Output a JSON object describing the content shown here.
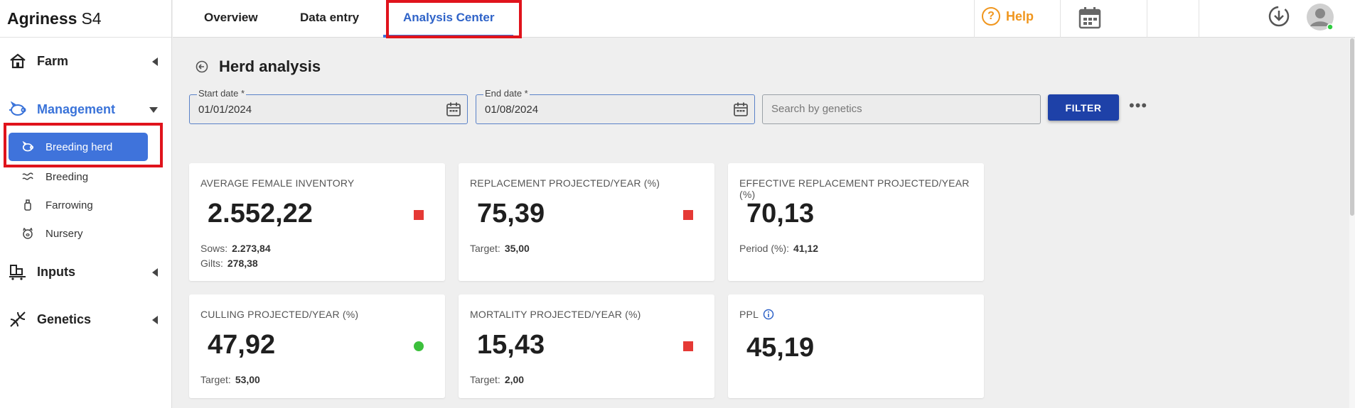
{
  "brand": {
    "name": "Agriness",
    "version": "S4"
  },
  "tabs": [
    {
      "label": "Overview"
    },
    {
      "label": "Data entry"
    },
    {
      "label": "Analysis Center"
    }
  ],
  "header": {
    "help_label": "Help"
  },
  "sidebar": {
    "sections": [
      {
        "label": "Farm"
      },
      {
        "label": "Management"
      },
      {
        "label": "Inputs"
      },
      {
        "label": "Genetics"
      }
    ],
    "management_items": [
      {
        "label": "Breeding herd"
      },
      {
        "label": "Breeding"
      },
      {
        "label": "Farrowing"
      },
      {
        "label": "Nursery"
      }
    ]
  },
  "page": {
    "title": "Herd analysis"
  },
  "filters": {
    "start_date_label": "Start date *",
    "start_date_value": "01/01/2024",
    "end_date_label": "End date *",
    "end_date_value": "01/08/2024",
    "search_placeholder": "Search by genetics",
    "filter_button": "FILTER",
    "more_label": "•••"
  },
  "cards": [
    {
      "label": "AVERAGE FEMALE INVENTORY",
      "value": "2.552,22",
      "status": "red",
      "subs": [
        {
          "k": "Sows:",
          "v": "2.273,84"
        },
        {
          "k": "Gilts:",
          "v": "278,38"
        }
      ]
    },
    {
      "label": "REPLACEMENT PROJECTED/YEAR (%)",
      "value": "75,39",
      "status": "red",
      "subs": [
        {
          "k": "Target:",
          "v": "35,00"
        }
      ]
    },
    {
      "label": "EFFECTIVE REPLACEMENT PROJECTED/YEAR (%)",
      "value": "70,13",
      "status": "none",
      "subs": [
        {
          "k": "Period (%):",
          "v": "41,12"
        }
      ]
    },
    {
      "label": "CULLING PROJECTED/YEAR (%)",
      "value": "47,92",
      "status": "green",
      "subs": [
        {
          "k": "Target:",
          "v": "53,00"
        }
      ]
    },
    {
      "label": "MORTALITY PROJECTED/YEAR (%)",
      "value": "15,43",
      "status": "red",
      "subs": [
        {
          "k": "Target:",
          "v": "2,00"
        }
      ]
    },
    {
      "label": "PPL",
      "value": "45,19",
      "status": "none",
      "subs": []
    }
  ],
  "colors": {
    "accent": "#3f73db",
    "red": "#e53935",
    "green": "#3cc03c",
    "help": "#f0961e",
    "highlight": "#e0131c"
  }
}
